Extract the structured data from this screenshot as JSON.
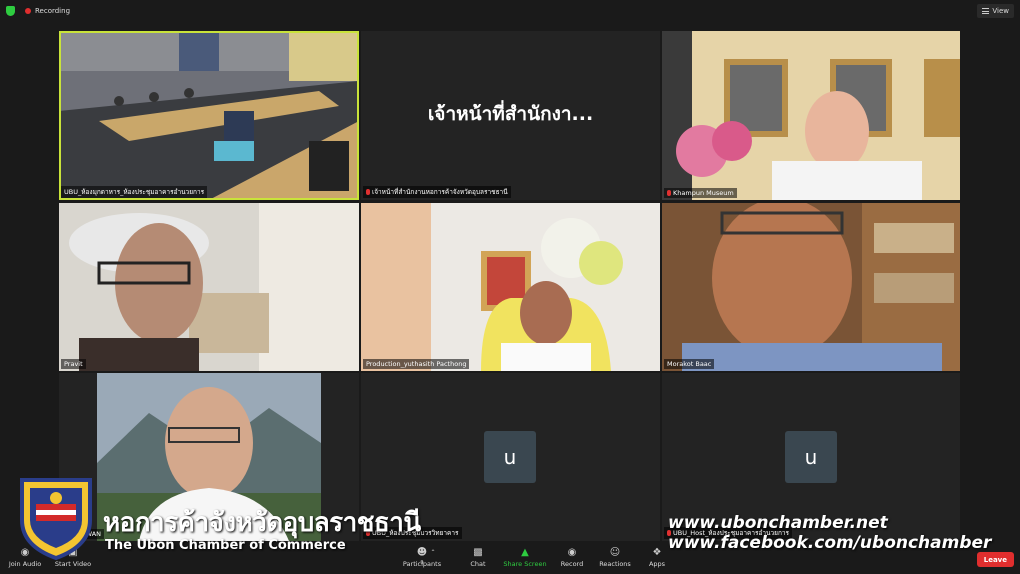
{
  "topbar": {
    "recording_label": "Recording",
    "view_label": "View"
  },
  "tiles": {
    "t1": {
      "name": "UBU_ห้องมุกดาหาร_ห้องประชุมอาคารอำนวยการ"
    },
    "t2": {
      "big_name": "เจ้าหน้าที่สำนักงา...",
      "name": "เจ้าหน้าที่สำนักงานหอการค้าจังหวัดอุบลราชธานี"
    },
    "t3": {
      "name": "Khampun Museum"
    },
    "t4": {
      "name": "Pravit"
    },
    "t5": {
      "name": "Production_yuthasith Pacthong"
    },
    "t6": {
      "name": "Morakot Baac"
    },
    "t7": {
      "name": "TANSUWAN"
    },
    "t8": {
      "avatar_letter": "u",
      "name": "UBU_ห้องประชุมบวรวิทยาคาร"
    },
    "t9": {
      "avatar_letter": "u",
      "name": "UBU_Host_ห้องประชุมอาคารอำนวยการ"
    }
  },
  "toolbar": {
    "join_audio": "Join Audio",
    "start_video": "Start Video",
    "participants": "Participants",
    "participants_count": "9",
    "chat": "Chat",
    "share_screen": "Share Screen",
    "record": "Record",
    "reactions": "Reactions",
    "apps": "Apps",
    "leave": "Leave"
  },
  "overlay": {
    "title": "หอการค้าจังหวัดอุบลราชธานี",
    "subtitle": "The Ubon Chamber of Commerce",
    "url1": "www.ubonchamber.net",
    "url2": "www.facebook.com/ubonchamber"
  }
}
